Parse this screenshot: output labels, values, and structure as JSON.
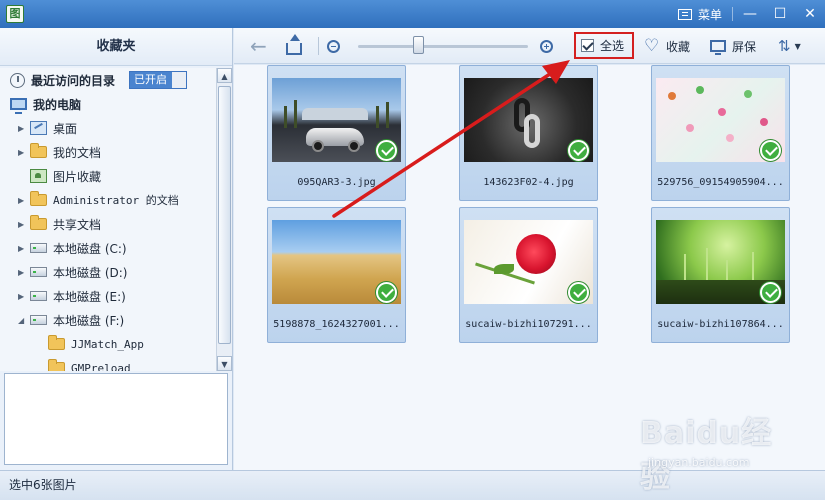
{
  "titlebar": {
    "app_icon_glyph": "图",
    "menu_label": "菜单",
    "minimize_glyph": "—",
    "maximize_glyph": "☐",
    "close_glyph": "✕"
  },
  "sidebar": {
    "title": "收藏夹",
    "recent": {
      "label": "最近访问的目录",
      "badge": "已开启"
    },
    "computer_label": "我的电脑",
    "items": [
      {
        "label": "桌面",
        "icon": "desktop-icon"
      },
      {
        "label": "我的文档",
        "icon": "folder-icon"
      },
      {
        "label": "图片收藏",
        "icon": "picture-icon"
      },
      {
        "label": "Administrator 的文档",
        "icon": "folder-icon"
      },
      {
        "label": "共享文档",
        "icon": "folder-icon"
      },
      {
        "label": "本地磁盘 (C:)",
        "icon": "disk-icon"
      },
      {
        "label": "本地磁盘 (D:)",
        "icon": "disk-icon"
      },
      {
        "label": "本地磁盘 (E:)",
        "icon": "disk-icon"
      },
      {
        "label": "本地磁盘 (F:)",
        "icon": "disk-icon"
      }
    ],
    "subfolders": [
      {
        "label": "JJMatch_App"
      },
      {
        "label": "GMPreload"
      }
    ]
  },
  "toolbar": {
    "select_all_label": "全选",
    "favorite_label": "收藏",
    "screen_label": "屏保",
    "zoom_level": 0.35,
    "accent_color": "#3e6aa6",
    "highlight_color": "#d42020"
  },
  "images": [
    {
      "filename": "095QAR3-3.jpg",
      "selected": true
    },
    {
      "filename": "143623F02-4.jpg",
      "selected": true
    },
    {
      "filename": "529756_09154905904...",
      "selected": true
    },
    {
      "filename": "5198878_1624327001...",
      "selected": true
    },
    {
      "filename": "sucaiw-bizhi107291...",
      "selected": true
    },
    {
      "filename": "sucaiw-bizhi107864...",
      "selected": true
    }
  ],
  "statusbar": {
    "text": "选中6张图片"
  },
  "watermark": {
    "brand": "Baidu经验",
    "url": "jingyan.baidu.com"
  }
}
